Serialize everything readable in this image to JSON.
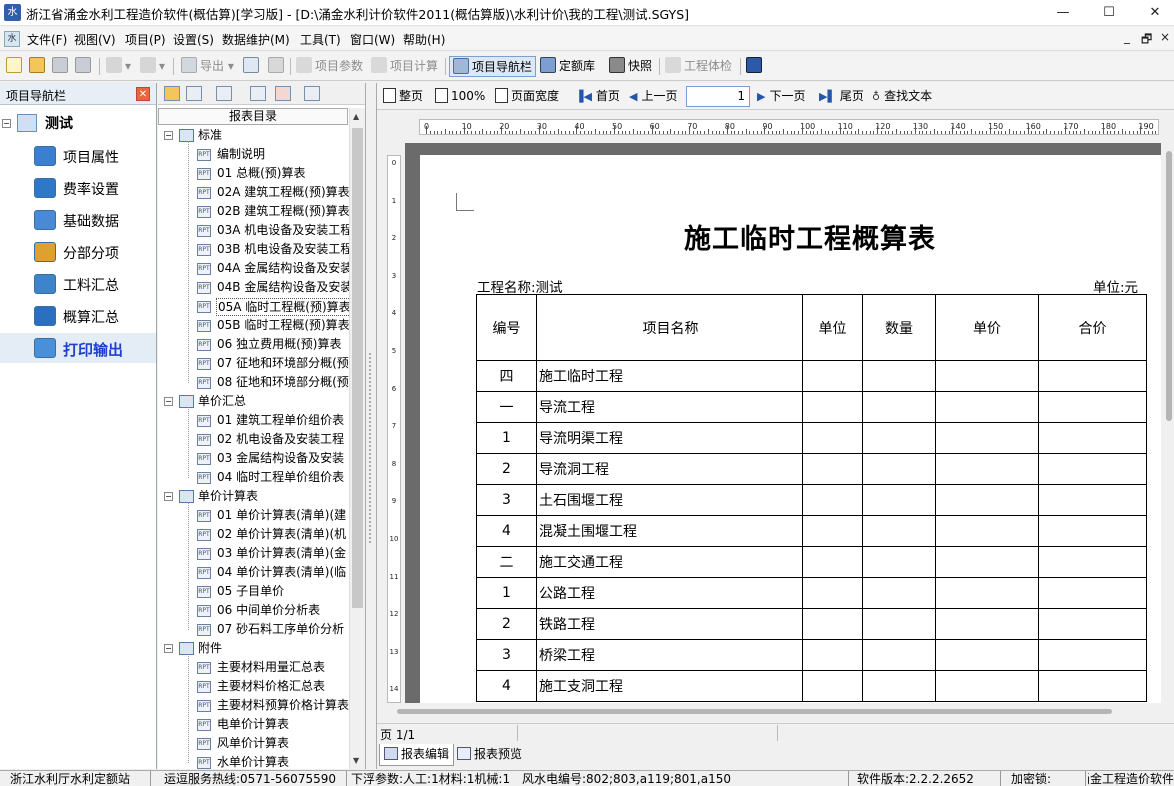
{
  "window": {
    "title": "浙江省涌金水利工程造价软件(概估算)[学习版] - [D:\\涌金水利计价软件2011(概估算版)\\水利计价\\我的工程\\测试.SGYS]",
    "app_icon": "水",
    "minimize": "—",
    "maximize": "☐",
    "close": "✕"
  },
  "menubar": {
    "items": [
      "文件(F)",
      "视图(V)",
      "项目(P)",
      "设置(S)",
      "数据维护(M)",
      "工具(T)",
      "窗口(W)",
      "帮助(H)"
    ],
    "mdi_controls": [
      "_",
      "🗗",
      "×"
    ]
  },
  "toolbar": {
    "export": "导出",
    "project_params": "项目参数",
    "project_calc": "项目计算",
    "project_nav": "项目导航栏",
    "quota_lib": "定额库",
    "snapshot": "快照",
    "project_check": "工程体检"
  },
  "left_nav": {
    "title": "项目导航栏",
    "close": "✕",
    "root": "测试",
    "root_toggle": "−",
    "items": [
      "项目属性",
      "费率设置",
      "基础数据",
      "分部分项",
      "工料汇总",
      "概算汇总",
      "打印输出"
    ],
    "active_index": 6,
    "colors": [
      "#3a7fd0",
      "#2f78c8",
      "#4a8ad4",
      "#e0a030",
      "#3d85c8",
      "#2b70c0",
      "#4a90d8"
    ]
  },
  "report_tree": {
    "header": "报表目录",
    "groups": [
      {
        "label": "标准",
        "items": [
          "编制说明",
          "01 总概(预)算表",
          "02A 建筑工程概(预)算表",
          "02B 建筑工程概(预)算表",
          "03A 机电设备及安装工程",
          "03B 机电设备及安装工程",
          "04A 金属结构设备及安装",
          "04B 金属结构设备及安装",
          "05A 临时工程概(预)算表",
          "05B 临时工程概(预)算表",
          "06 独立费用概(预)算表",
          "07 征地和环境部分概(预",
          "08 征地和环境部分概(预"
        ]
      },
      {
        "label": "单价汇总",
        "items": [
          "01 建筑工程单价组价表",
          "02 机电设备及安装工程",
          "03 金属结构设备及安装",
          "04 临时工程单价组价表"
        ]
      },
      {
        "label": "单价计算表",
        "items": [
          "01 单价计算表(清单)(建",
          "02 单价计算表(清单)(机",
          "03 单价计算表(清单)(金",
          "04 单价计算表(清单)(临",
          "05 子目单价",
          "06 中间单价分析表",
          "07 砂石料工序单价分析"
        ]
      },
      {
        "label": "附件",
        "items": [
          "主要材料用量汇总表",
          "主要材料价格汇总表",
          "主要材料预算价格计算表",
          "电单价计算表",
          "风单价计算表",
          "水单价计算表"
        ]
      }
    ],
    "selected": "05A 临时工程概(预)算表",
    "group_toggle": "−",
    "leaf_icon": "RPT"
  },
  "report_toolbar": {
    "fit_page": "整页",
    "zoom": "100%",
    "page_width": "页面宽度",
    "first": "首页",
    "prev": "上一页",
    "page": "1",
    "next": "下一页",
    "last": "尾页",
    "find": "查找文本"
  },
  "ruler": {
    "h_labels": [
      "0",
      "10",
      "20",
      "30",
      "40",
      "50",
      "60",
      "70",
      "80",
      "90",
      "100",
      "110",
      "120",
      "130",
      "140",
      "150",
      "160",
      "170",
      "180",
      "190"
    ],
    "v_labels": [
      "0",
      "1",
      "2",
      "3",
      "4",
      "5",
      "6",
      "7",
      "8",
      "9",
      "10",
      "11",
      "12",
      "13",
      "14"
    ]
  },
  "report": {
    "title": "施工临时工程概算表",
    "project_name": "工程名称:测试",
    "unit": "单位:元",
    "headers": [
      "编号",
      "项目名称",
      "单位",
      "数量",
      "单价",
      "合价"
    ],
    "rows": [
      [
        "四",
        "施工临时工程"
      ],
      [
        "一",
        "导流工程"
      ],
      [
        "1",
        "导流明渠工程"
      ],
      [
        "2",
        "导流洞工程"
      ],
      [
        "3",
        "土石围堰工程"
      ],
      [
        "4",
        "混凝土围堰工程"
      ],
      [
        "二",
        "施工交通工程"
      ],
      [
        "1",
        "公路工程"
      ],
      [
        "2",
        "铁路工程"
      ],
      [
        "3",
        "桥梁工程"
      ],
      [
        "4",
        "施工支洞工程"
      ]
    ]
  },
  "report_status": {
    "page": "页 1/1"
  },
  "report_tabs": [
    "报表编辑",
    "报表预览"
  ],
  "statusbar": {
    "org": "浙江水利厅水利定额站",
    "hotline": "运逗服务热线:0571-56075590",
    "float": "下浮参数:人工:1材料:1机械:1",
    "wind_water": "风水电编号:802;803,a119;801,a150",
    "version": "软件版本:2.2.2.2652",
    "lock": "加密锁:",
    "brand": "涌金工程造价软件"
  }
}
